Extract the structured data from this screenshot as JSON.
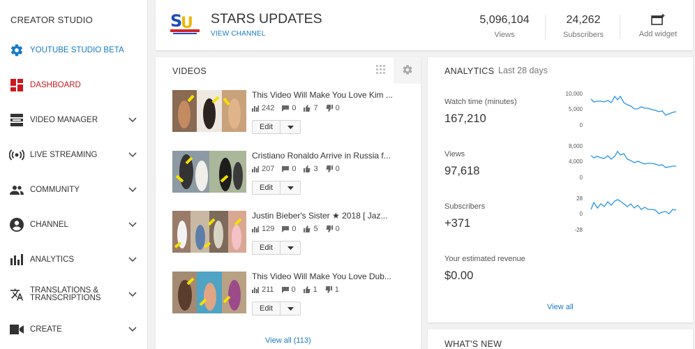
{
  "sidebar": {
    "title": "CREATOR STUDIO",
    "items": [
      {
        "label": "YOUTUBE STUDIO BETA",
        "icon": "gear-icon"
      },
      {
        "label": "DASHBOARD",
        "icon": "dashboard-icon"
      },
      {
        "label": "VIDEO MANAGER",
        "icon": "video-manager-icon"
      },
      {
        "label": "LIVE STREAMING",
        "icon": "live-streaming-icon"
      },
      {
        "label": "COMMUNITY",
        "icon": "community-icon"
      },
      {
        "label": "CHANNEL",
        "icon": "account-circle-icon"
      },
      {
        "label": "ANALYTICS",
        "icon": "bar-chart-icon"
      },
      {
        "label_line1": "TRANSLATIONS &",
        "label_line2": "TRANSCRIPTIONS",
        "icon": "translate-icon"
      },
      {
        "label": "CREATE",
        "icon": "video-camera-icon"
      }
    ]
  },
  "header": {
    "channel_name": "STARS UPDATES",
    "view_channel": "VIEW CHANNEL",
    "views_value": "5,096,104",
    "views_label": "Views",
    "subscribers_value": "24,262",
    "subscribers_label": "Subscribers",
    "add_widget_label": "Add widget"
  },
  "videos": {
    "title": "VIDEOS",
    "edit_label": "Edit",
    "view_all": "View all (113)",
    "items": [
      {
        "title": "This Video Will Make You Love Kim ...",
        "views": "242",
        "comments": "0",
        "likes": "7",
        "dislikes": "0"
      },
      {
        "title": "Cristiano Ronaldo Arrive in Russia f...",
        "views": "207",
        "comments": "0",
        "likes": "3",
        "dislikes": "0"
      },
      {
        "title": "Justin Bieber's Sister ★ 2018 [ Jaz...",
        "views": "129",
        "comments": "0",
        "likes": "5",
        "dislikes": "0"
      },
      {
        "title": "This Video Will Make You Love Dub...",
        "views": "211",
        "comments": "0",
        "likes": "1",
        "dislikes": "1"
      }
    ]
  },
  "analytics": {
    "title": "ANALYTICS",
    "period": "Last 28 days",
    "view_all": "View all",
    "metrics": [
      {
        "label": "Watch time (minutes)",
        "value": "167,210",
        "ticks": [
          "10,000",
          "5,000",
          "0"
        ]
      },
      {
        "label": "Views",
        "value": "97,618",
        "ticks": [
          "8,000",
          "4,000",
          "0"
        ]
      },
      {
        "label": "Subscribers",
        "value": "+371",
        "ticks": [
          "28",
          "0",
          "-28"
        ]
      },
      {
        "label": "Your estimated revenue",
        "value": "$0.00"
      }
    ]
  },
  "whats_new": {
    "title": "WHAT'S NEW"
  },
  "colors": {
    "accent": "#167ac6",
    "dashboard": "#cc181e",
    "spark": "#2793e6"
  }
}
